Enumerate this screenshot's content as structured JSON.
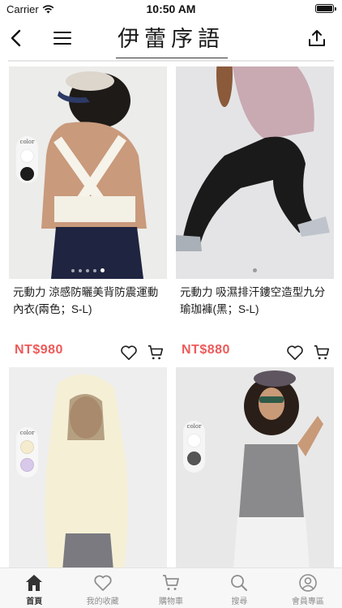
{
  "status_bar": {
    "carrier": "Carrier",
    "time": "10:50 AM"
  },
  "nav": {
    "logo": "伊蕾序語"
  },
  "products": [
    {
      "name": "元動力 涼感防曬美背防震運動內衣(兩色；S-L)",
      "price": "",
      "color_label": "color",
      "colors": [
        "#ffffff",
        "#1c1c1c"
      ],
      "image_dots": 5,
      "active_dot": 4
    },
    {
      "name": "元動力 吸濕排汗鏤空造型九分瑜珈褲(黑；S-L)",
      "price": "",
      "image_dots": 1,
      "active_dot": 0
    },
    {
      "name": "",
      "price": "NT$980",
      "color_label": "color",
      "colors": [
        "#f5ecd0",
        "#d8c8ea"
      ],
      "image_dots": 5,
      "active_dot": 0
    },
    {
      "name": "",
      "price": "NT$880",
      "color_label": "color",
      "colors": [
        "#ffffff",
        "#555555"
      ]
    }
  ],
  "tab_bar": [
    {
      "label": "首頁",
      "icon": "home-icon",
      "active": true
    },
    {
      "label": "我的收藏",
      "icon": "heart-icon",
      "active": false
    },
    {
      "label": "購物車",
      "icon": "cart-icon",
      "active": false
    },
    {
      "label": "搜尋",
      "icon": "search-icon",
      "active": false
    },
    {
      "label": "會員專區",
      "icon": "user-icon",
      "active": false
    }
  ],
  "colors": {
    "price": "#ee5a5a",
    "tab_bar_bg": "#f7f7f7"
  }
}
